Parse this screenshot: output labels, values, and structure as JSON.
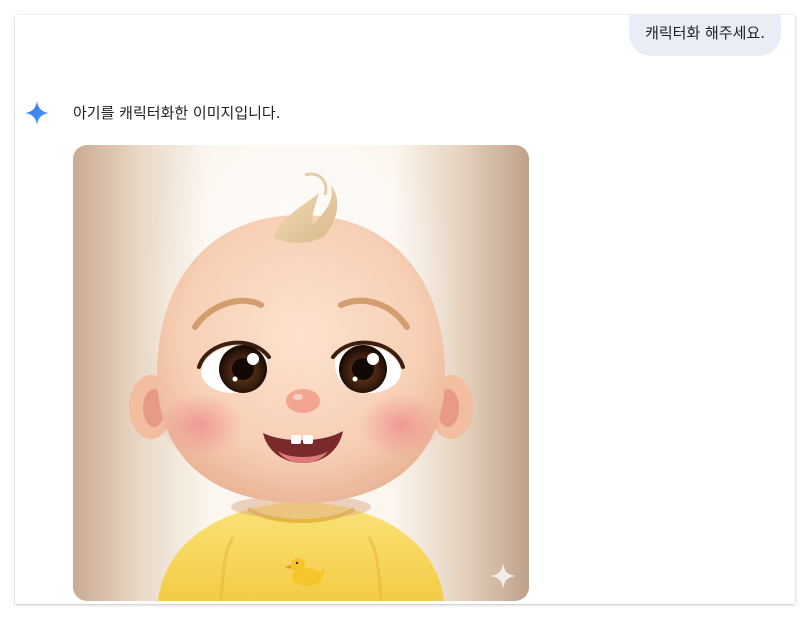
{
  "conversation": {
    "user_message": "캐릭터화 해주세요.",
    "assistant_message": "아기를 캐릭터화한 이미지입니다."
  },
  "icons": {
    "assistant_avatar": "gemini-sparkle-icon",
    "image_watermark": "sparkle-watermark-icon"
  },
  "colors": {
    "user_bubble_bg": "#e9eef6",
    "gemini_blue": "#4285f4",
    "text": "#1f1f1f"
  }
}
